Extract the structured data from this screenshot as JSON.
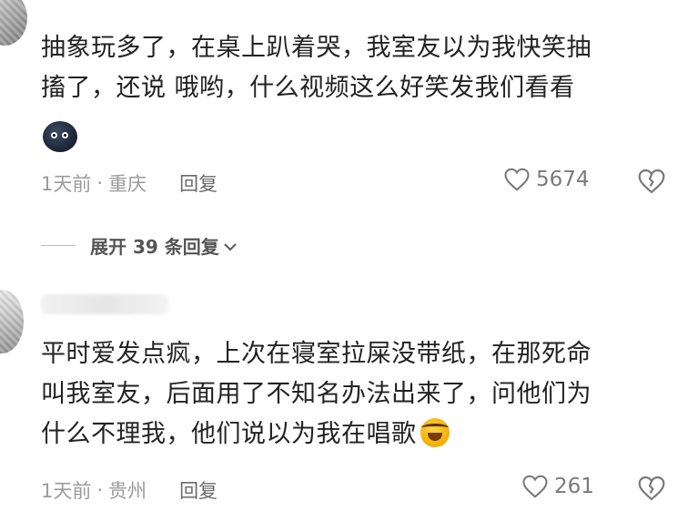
{
  "comments": [
    {
      "lines": [
        "抽象玩多了，在桌上趴着哭，我室友以为我快笑抽",
        "搐了，还说 哦哟，什么视频这么好笑发我们看看"
      ],
      "emoji": "blob-emoji",
      "time": "1天前",
      "location": "重庆",
      "reply_label": "回复",
      "likes": "5674"
    },
    {
      "lines": [
        "平时爱发点疯，上次在寝室拉屎没带纸，在那死命",
        "叫我室友，后面用了不知名办法出来了，问他们为",
        "什么不理我，他们说以为我在唱歌"
      ],
      "emoji": "laughing-crying-emoji",
      "time": "1天前",
      "location": "贵州",
      "reply_label": "回复",
      "likes": "261"
    }
  ],
  "expand_replies": "展开 39 条回复",
  "dot": "·"
}
